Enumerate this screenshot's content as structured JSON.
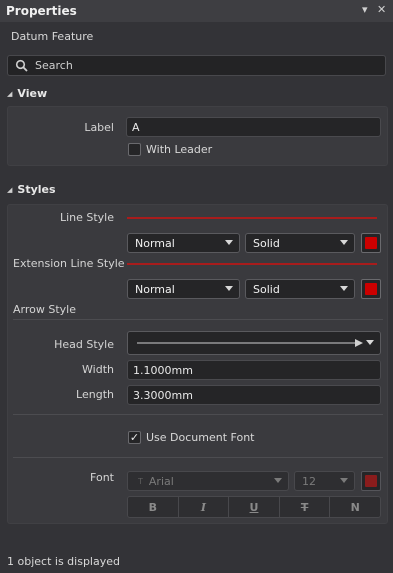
{
  "panel": {
    "title": "Properties",
    "pin_glyph": "▾",
    "close_glyph": "✕",
    "subtitle": "Datum Feature",
    "search_placeholder": "Search"
  },
  "view": {
    "header": "View",
    "label_caption": "Label",
    "label_value": "A",
    "with_leader_label": "With Leader",
    "with_leader_checked": false
  },
  "styles": {
    "header": "Styles",
    "line_style_caption": "Line Style",
    "line_style_width": "Normal",
    "line_style_pattern": "Solid",
    "line_style_color": "#cc0000",
    "extension_line_style_caption": "Extension Line Style",
    "extension_line_width": "Normal",
    "extension_line_pattern": "Solid",
    "extension_line_color": "#cc0000",
    "arrow_style_caption": "Arrow Style",
    "head_style_caption": "Head Style",
    "width_caption": "Width",
    "width_value": "1.1000mm",
    "length_caption": "Length",
    "length_value": "3.3000mm",
    "use_document_font_label": "Use Document Font",
    "use_document_font_checked": true,
    "check_glyph": "✓",
    "font_caption": "Font",
    "font_family": "Arial",
    "font_size": "12",
    "font_color": "#8a1c1c",
    "format_buttons": [
      "B",
      "I",
      "U",
      "T",
      "N"
    ]
  },
  "status": "1 object is displayed"
}
